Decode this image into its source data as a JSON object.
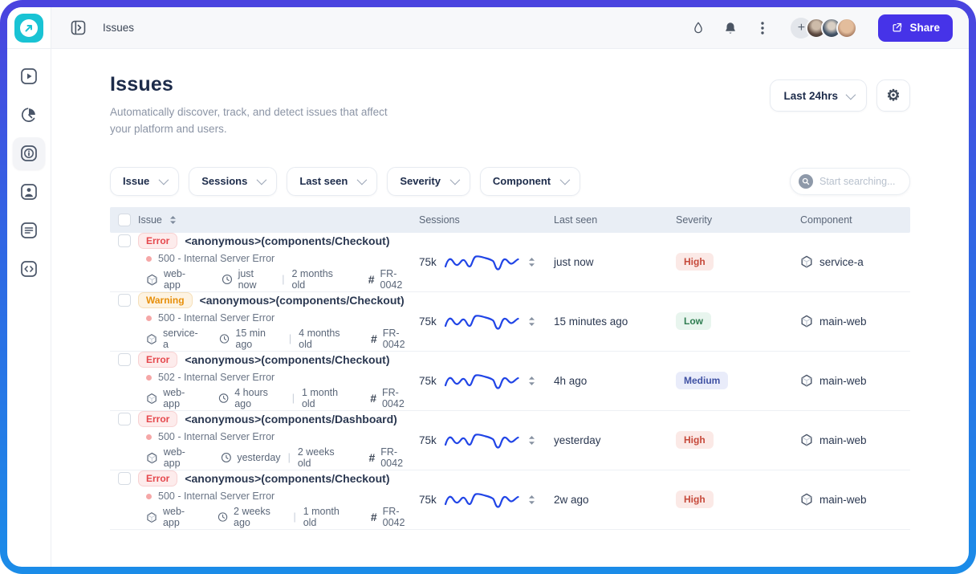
{
  "topbar": {
    "breadcrumb": "Issues",
    "share_label": "Share",
    "icons": [
      "droplet-icon",
      "bell-icon",
      "kebab-menu-icon",
      "add-member-icon"
    ],
    "avatar_count": 3
  },
  "sidebar": {
    "items": [
      {
        "icon": "play-icon",
        "active": false
      },
      {
        "icon": "pie-chart-icon",
        "active": false
      },
      {
        "icon": "info-icon",
        "active": true
      },
      {
        "icon": "user-icon",
        "active": false
      },
      {
        "icon": "document-icon",
        "active": false
      },
      {
        "icon": "code-icon",
        "active": false
      }
    ]
  },
  "page": {
    "title": "Issues",
    "subtitle": "Automatically discover, track, and detect issues that affect your platform and users.",
    "time_range": "Last 24hrs"
  },
  "filters": [
    {
      "label": "Issue"
    },
    {
      "label": "Sessions"
    },
    {
      "label": "Last seen"
    },
    {
      "label": "Severity"
    },
    {
      "label": "Component"
    }
  ],
  "search": {
    "placeholder": "Start searching..."
  },
  "colors": {
    "logo_teal": "#19c3d4",
    "share_accent": "#4633e8",
    "sparkline_blue": "#2145e6",
    "error_red": "#e5484d",
    "warning_orange": "#e78f0a",
    "severity_high": "#c6493a",
    "severity_low": "#2f7d51",
    "severity_medium": "#3f51a3",
    "frame_gradient_top": "#4a43df",
    "frame_gradient_bottom": "#1b8ce8"
  },
  "table": {
    "columns": [
      "Issue",
      "Sessions",
      "Last seen",
      "Severity",
      "Component"
    ],
    "rows": [
      {
        "badge": "Error",
        "badge_type": "error",
        "title": "<anonymous>(components/Checkout)",
        "subtitle": "500 - Internal Server Error",
        "app": "web-app",
        "time_recent": "just now",
        "time_old": "2 months old",
        "ref": "FR-0042",
        "sessions": "75k",
        "last_seen": "just now",
        "severity": "High",
        "severity_type": "high",
        "component": "service-a"
      },
      {
        "badge": "Warning",
        "badge_type": "warning",
        "title": "<anonymous>(components/Checkout)",
        "subtitle": "500 - Internal Server Error",
        "app": "service-a",
        "time_recent": "15 min ago",
        "time_old": "4 months old",
        "ref": "FR-0042",
        "sessions": "75k",
        "last_seen": "15 minutes ago",
        "severity": "Low",
        "severity_type": "low",
        "component": "main-web"
      },
      {
        "badge": "Error",
        "badge_type": "error",
        "title": "<anonymous>(components/Checkout)",
        "subtitle": "502 - Internal Server Error",
        "app": "web-app",
        "time_recent": "4 hours ago",
        "time_old": "1 month old",
        "ref": "FR-0042",
        "sessions": "75k",
        "last_seen": "4h ago",
        "severity": "Medium",
        "severity_type": "medium",
        "component": "main-web"
      },
      {
        "badge": "Error",
        "badge_type": "error",
        "title": "<anonymous>(components/Dashboard)",
        "subtitle": "500 - Internal Server Error",
        "app": "web-app",
        "time_recent": "yesterday",
        "time_old": "2 weeks old",
        "ref": "FR-0042",
        "sessions": "75k",
        "last_seen": "yesterday",
        "severity": "High",
        "severity_type": "high",
        "component": "main-web"
      },
      {
        "badge": "Error",
        "badge_type": "error",
        "title": "<anonymous>(components/Checkout)",
        "subtitle": "500 - Internal Server Error",
        "app": "web-app",
        "time_recent": "2 weeks ago",
        "time_old": "1 month old",
        "ref": "FR-0042",
        "sessions": "75k",
        "last_seen": "2w ago",
        "severity": "High",
        "severity_type": "high",
        "component": "main-web"
      }
    ]
  }
}
